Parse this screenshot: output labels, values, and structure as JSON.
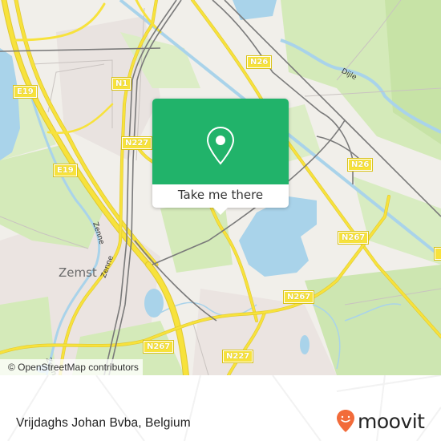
{
  "map": {
    "road_shields": [
      {
        "id": "n1",
        "label": "N1"
      },
      {
        "id": "e19-top",
        "label": "E19"
      },
      {
        "id": "e19-mid",
        "label": "E19"
      },
      {
        "id": "n227-top",
        "label": "N227"
      },
      {
        "id": "n26-top",
        "label": "N26"
      },
      {
        "id": "n26-right",
        "label": "N26"
      },
      {
        "id": "n267-right",
        "label": "N267"
      },
      {
        "id": "n267-mid",
        "label": "N267"
      },
      {
        "id": "n267-left",
        "label": "N267"
      },
      {
        "id": "n227-bottom",
        "label": "N227"
      }
    ],
    "place_labels": [
      {
        "id": "zemst",
        "label": "Zemst"
      }
    ],
    "water_labels": [
      {
        "id": "dijle",
        "label": "Dijle"
      },
      {
        "id": "zenne-1",
        "label": "Zenne"
      },
      {
        "id": "zenne-2",
        "label": "Zenne"
      },
      {
        "id": "zenne-3",
        "label": "Zenne"
      }
    ],
    "colors": {
      "land": "#f1efea",
      "forest": "#cfe8b4",
      "water": "#a9d3ea",
      "road_major": "#f7e23c",
      "rail": "#777777"
    }
  },
  "popup": {
    "button_label": "Take me there",
    "color": "#21b36a",
    "icon": "map-pin-icon"
  },
  "attribution": {
    "text": "© OpenStreetMap contributors"
  },
  "footer": {
    "place_name": "Vrijdaghs Johan Bvba, Belgium",
    "brand": "moovit",
    "brand_color": "#f26b3a"
  }
}
